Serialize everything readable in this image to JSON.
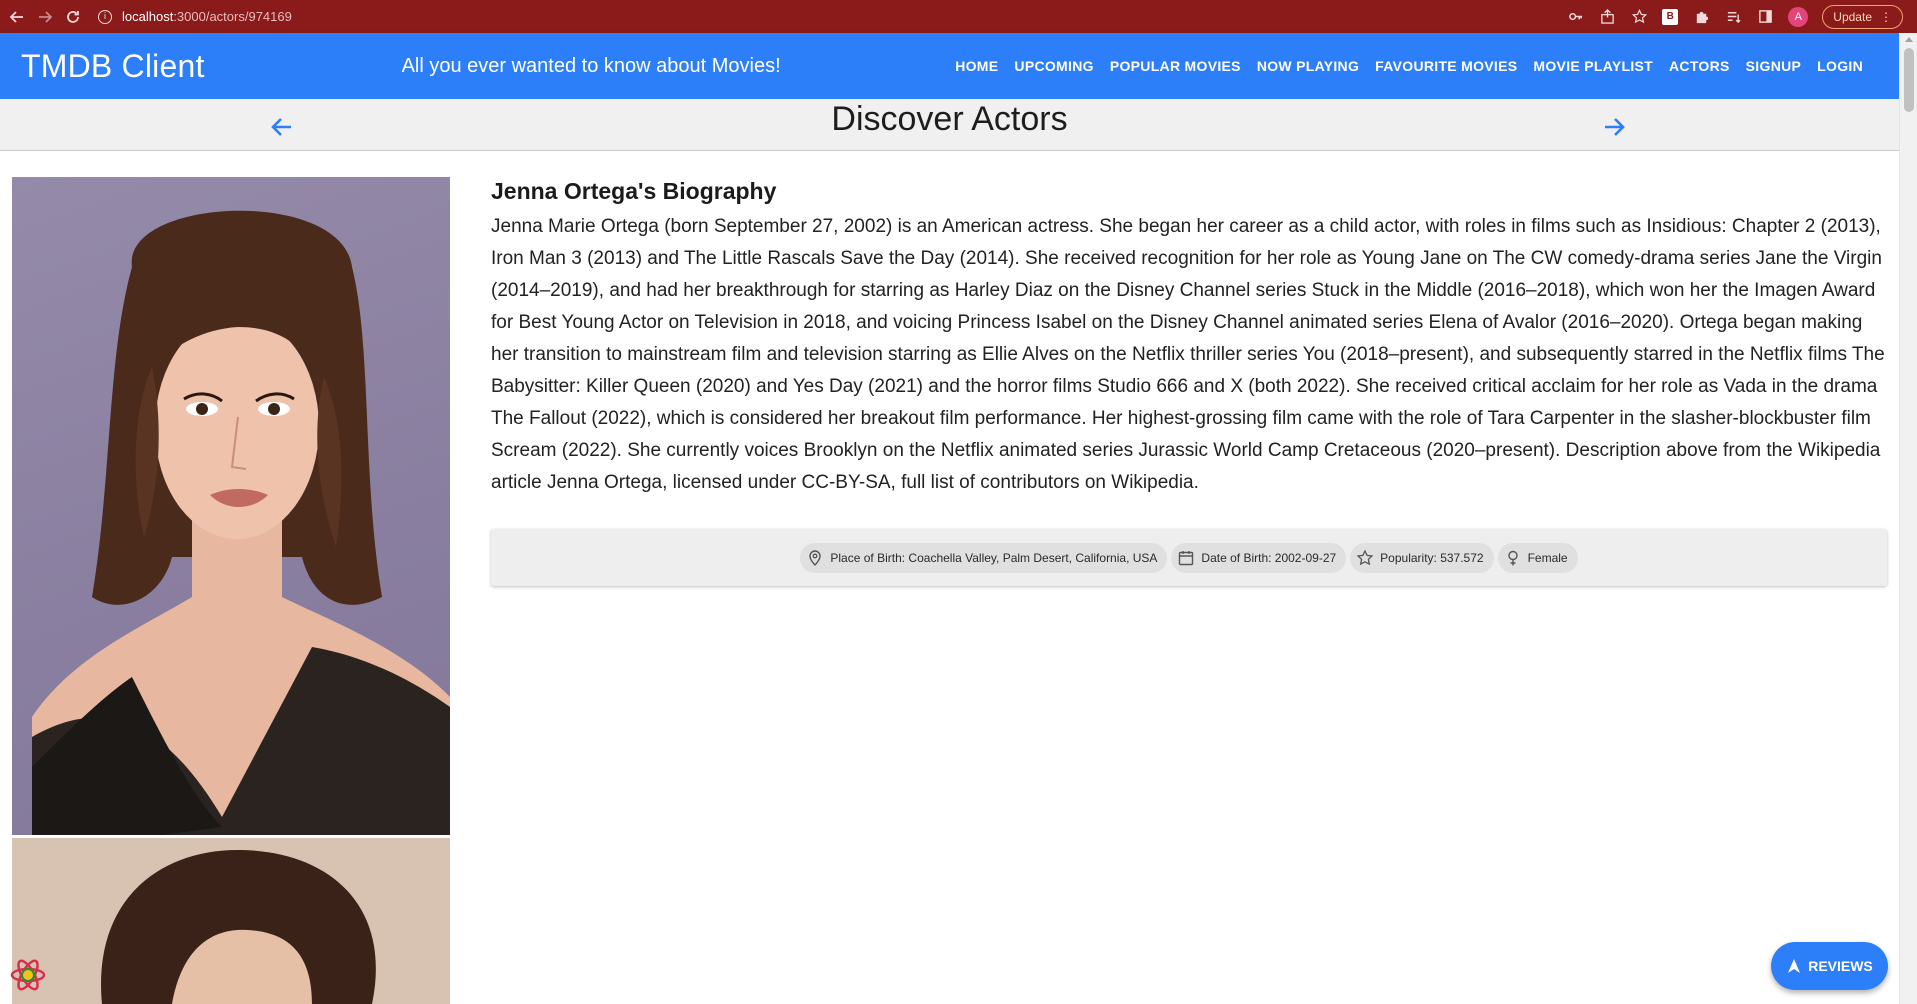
{
  "browser": {
    "url_host": "localhost",
    "url_path": ":3000/actors/974169",
    "profile_initial": "A",
    "extension_label": "B",
    "update_label": "Update"
  },
  "appbar": {
    "brand": "TMDB Client",
    "tagline": "All you ever wanted to know about Movies!",
    "menu": [
      "HOME",
      "UPCOMING",
      "POPULAR MOVIES",
      "NOW PLAYING",
      "FAVOURITE MOVIES",
      "MOVIE PLAYLIST",
      "ACTORS",
      "SIGNUP",
      "LOGIN"
    ]
  },
  "discover": {
    "title": "Discover Actors"
  },
  "actor": {
    "bio_title": "Jenna Ortega's Biography",
    "bio_text": "Jenna Marie Ortega (born September 27, 2002) is an American actress. She began her career as a child actor, with roles in films such as Insidious: Chapter 2 (2013), Iron Man 3 (2013) and The Little Rascals Save the Day (2014). She received recognition for her role as Young Jane on The CW comedy-drama series Jane the Virgin (2014–2019), and had her breakthrough for starring as Harley Diaz on the Disney Channel series Stuck in the Middle (2016–2018), which won her the Imagen Award for Best Young Actor on Television in 2018, and voicing Princess Isabel on the Disney Channel animated series Elena of Avalor (2016–2020). Ortega began making her transition to mainstream film and television starring as Ellie Alves on the Netflix thriller series You (2018–present), and subsequently starred in the Netflix films The Babysitter: Killer Queen (2020) and Yes Day (2021) and the horror films Studio 666 and X (both 2022). She received critical acclaim for her role as Vada in the drama The Fallout (2022), which is considered her breakout film performance. Her highest-grossing film came with the role of Tara Carpenter in the slasher-blockbuster film Scream (2022). She currently voices Brooklyn on the Netflix animated series Jurassic World Camp Cretaceous (2020–present). Description above from the Wikipedia article Jenna Ortega, licensed under CC-BY-SA, full list of contributors on Wikipedia.",
    "chips": {
      "place_of_birth": "Place of Birth: Coachella Valley, Palm Desert, California, USA",
      "date_of_birth": "Date of Birth: 2002-09-27",
      "popularity": "Popularity: 537.572",
      "gender": "Female"
    }
  },
  "fab": {
    "reviews_label": "REVIEWS"
  },
  "colors": {
    "browser_bar": "#8b1a1a",
    "appbar": "#2d7ff9",
    "arrow": "#2d7ff9"
  }
}
